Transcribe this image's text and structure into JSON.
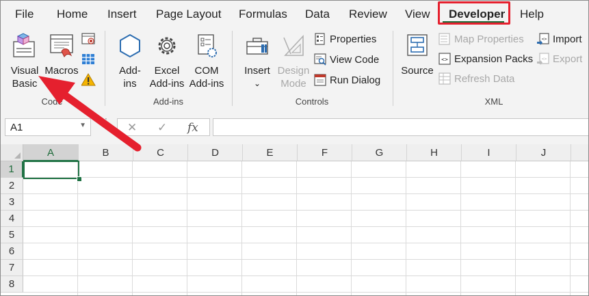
{
  "menu": {
    "tabs": [
      "File",
      "Home",
      "Insert",
      "Page Layout",
      "Formulas",
      "Data",
      "Review",
      "View",
      "Developer",
      "Help"
    ],
    "active": "Developer"
  },
  "ribbon": {
    "code": {
      "label": "Code",
      "visual_basic": [
        "Visual",
        "Basic"
      ],
      "macros": "Macros"
    },
    "addins": {
      "label": "Add-ins",
      "addins": [
        "Add-",
        "ins"
      ],
      "excel_addins": [
        "Excel",
        "Add-ins"
      ],
      "com_addins": [
        "COM",
        "Add-ins"
      ]
    },
    "controls": {
      "label": "Controls",
      "insert": "Insert",
      "design_mode": [
        "Design",
        "Mode"
      ],
      "properties": "Properties",
      "view_code": "View Code",
      "run_dialog": "Run Dialog"
    },
    "xml": {
      "label": "XML",
      "source": "Source",
      "map_properties": "Map Properties",
      "expansion_packs": "Expansion Packs",
      "refresh_data": "Refresh Data",
      "import": "Import",
      "export": "Export"
    }
  },
  "formula_bar": {
    "name_box": "A1",
    "cancel_symbol": "✕",
    "enter_symbol": "✓",
    "fx_symbol": "fx",
    "formula": ""
  },
  "grid": {
    "columns": [
      "A",
      "B",
      "C",
      "D",
      "E",
      "F",
      "G",
      "H",
      "I",
      "J"
    ],
    "rows": [
      "1",
      "2",
      "3",
      "4",
      "5",
      "6",
      "7",
      "8"
    ],
    "active_cell": "A1"
  },
  "colors": {
    "excel_green": "#1f7244",
    "highlight_red": "#e5202e",
    "ribbon_bg": "#f3f3f3"
  }
}
